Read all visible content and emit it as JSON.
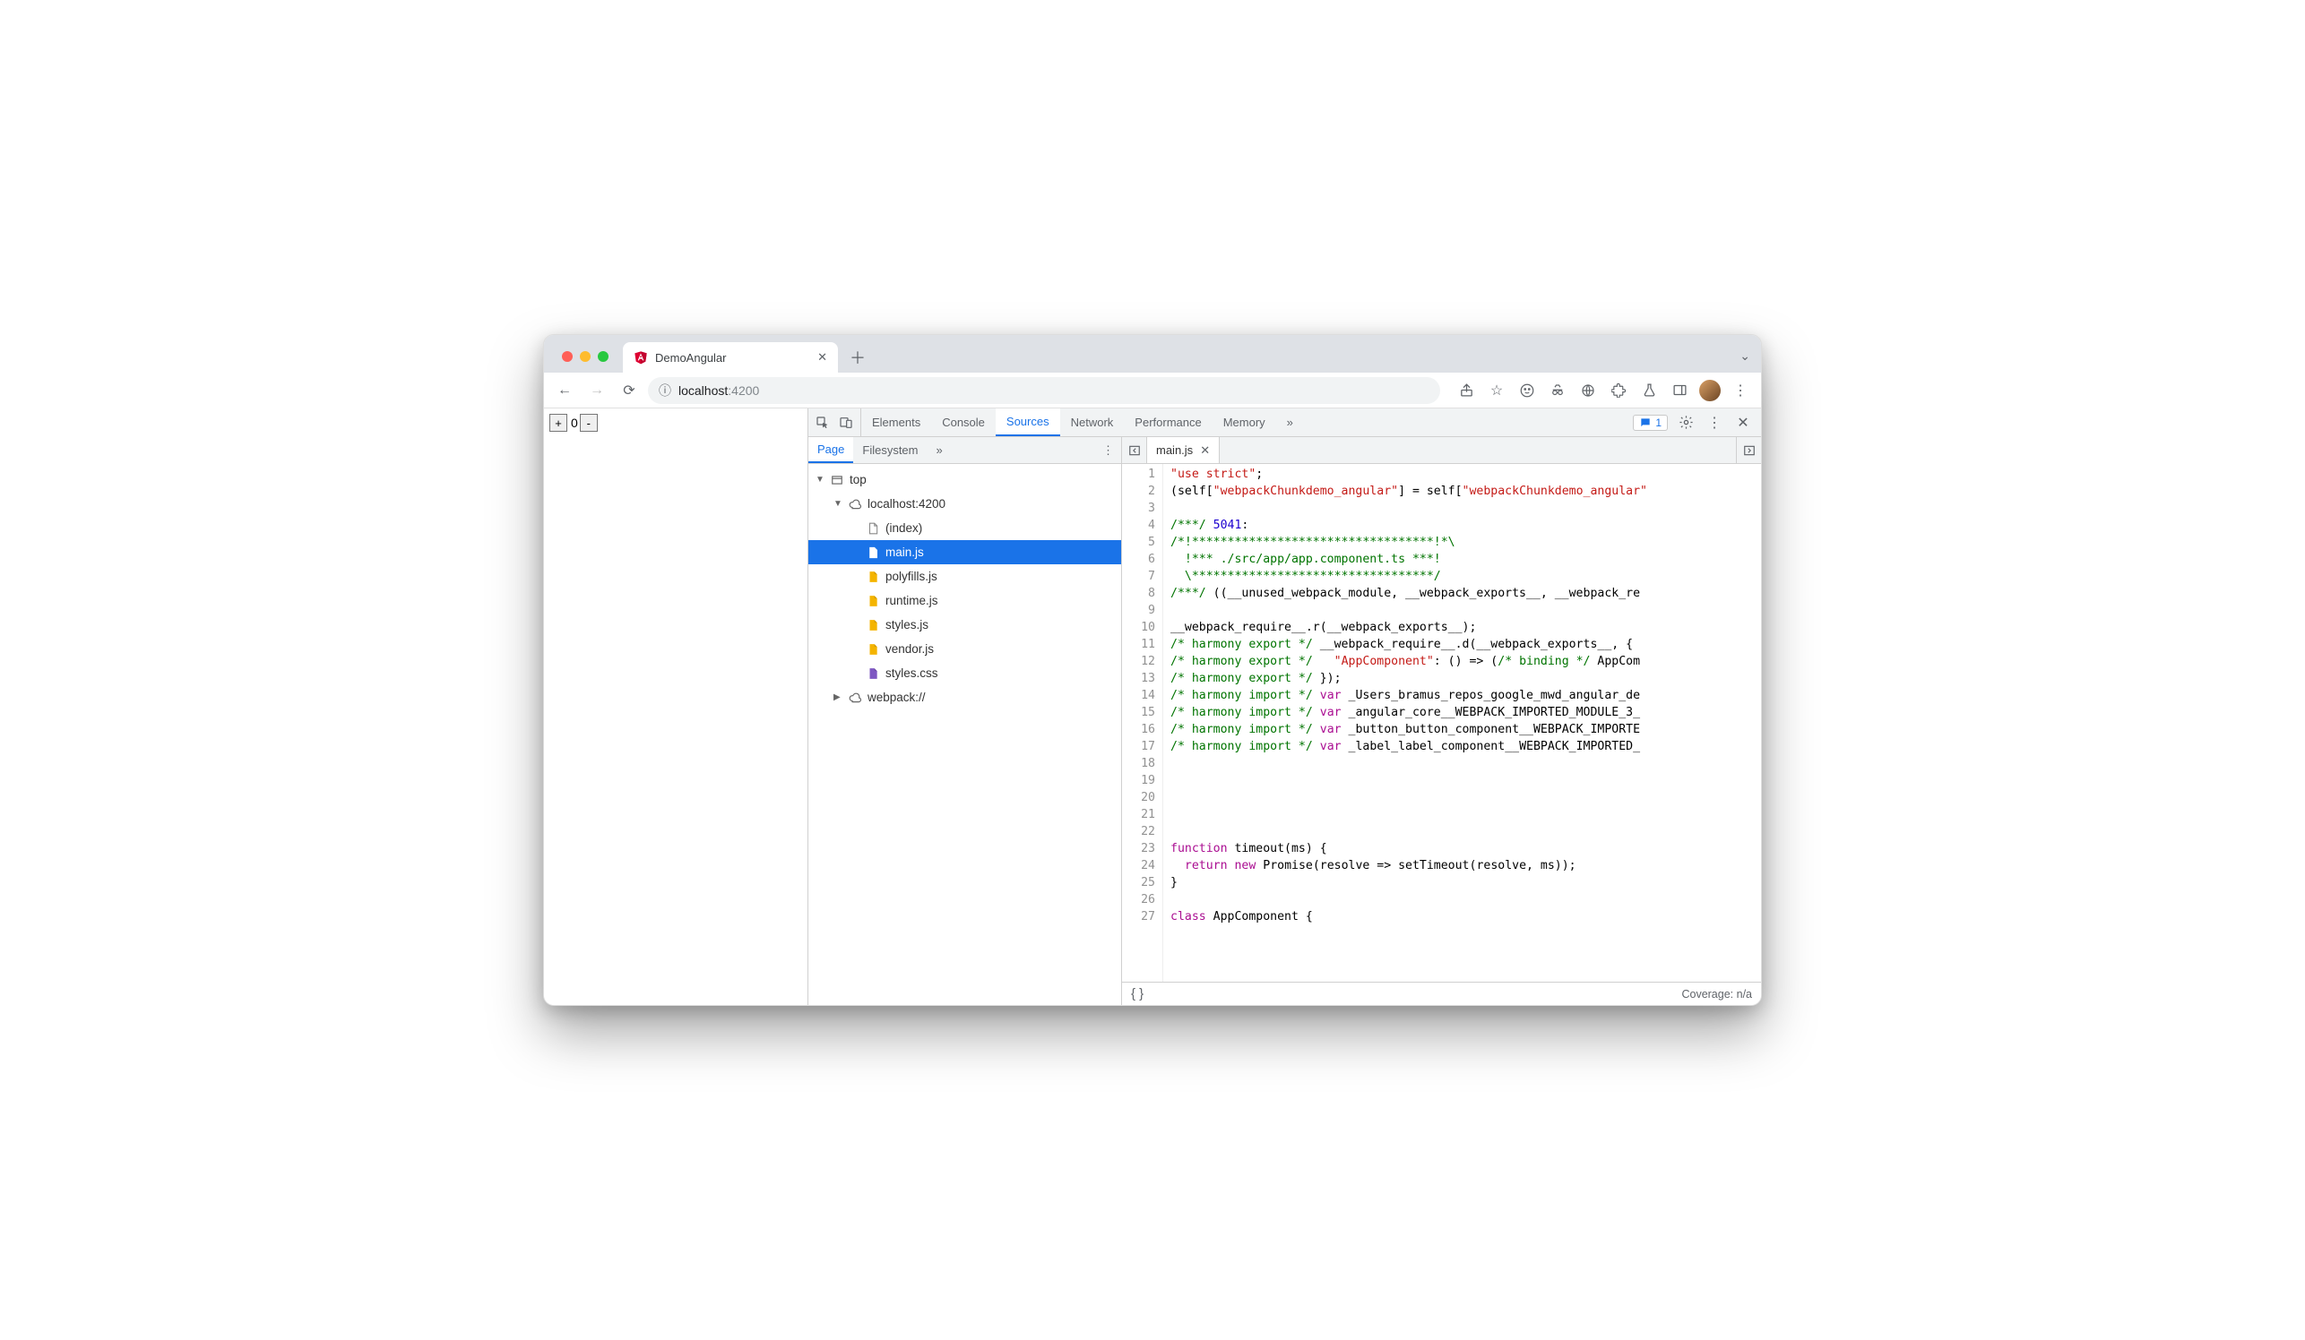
{
  "browser": {
    "tab_title": "DemoAngular",
    "url_host": "localhost",
    "url_port": ":4200",
    "counter_value": "0"
  },
  "devtools": {
    "tabs": [
      "Elements",
      "Console",
      "Sources",
      "Network",
      "Performance",
      "Memory"
    ],
    "active_tab": "Sources",
    "issues_count": "1",
    "navigator": {
      "tabs": [
        "Page",
        "Filesystem"
      ],
      "active_tab": "Page",
      "tree": {
        "top": "top",
        "origin": "localhost:4200",
        "files": [
          {
            "name": "(index)",
            "type": "html"
          },
          {
            "name": "main.js",
            "type": "js",
            "selected": true
          },
          {
            "name": "polyfills.js",
            "type": "js"
          },
          {
            "name": "runtime.js",
            "type": "js"
          },
          {
            "name": "styles.js",
            "type": "js"
          },
          {
            "name": "vendor.js",
            "type": "js"
          },
          {
            "name": "styles.css",
            "type": "css"
          }
        ],
        "webpack": "webpack://"
      }
    },
    "editor": {
      "open_file": "main.js",
      "coverage": "Coverage: n/a"
    }
  },
  "code_lines": [
    [
      {
        "t": "str",
        "v": "\"use strict\""
      },
      {
        "t": "",
        "v": ";"
      }
    ],
    [
      {
        "t": "",
        "v": "(self["
      },
      {
        "t": "prop",
        "v": "\"webpackChunkdemo_angular\""
      },
      {
        "t": "",
        "v": "] = self["
      },
      {
        "t": "prop",
        "v": "\"webpackChunkdemo_angular\""
      }
    ],
    [],
    [
      {
        "t": "com",
        "v": "/***/ "
      },
      {
        "t": "num",
        "v": "5041"
      },
      {
        "t": "",
        "v": ":"
      }
    ],
    [
      {
        "t": "com",
        "v": "/*!**********************************!*\\"
      }
    ],
    [
      {
        "t": "com",
        "v": "  !*** ./src/app/app.component.ts ***!"
      }
    ],
    [
      {
        "t": "com",
        "v": "  \\**********************************/"
      }
    ],
    [
      {
        "t": "com",
        "v": "/***/"
      },
      {
        "t": "",
        "v": " ((__unused_webpack_module, __webpack_exports__, __webpack_re"
      }
    ],
    [],
    [
      {
        "t": "",
        "v": "__webpack_require__.r(__webpack_exports__);"
      }
    ],
    [
      {
        "t": "com",
        "v": "/* harmony export */"
      },
      {
        "t": "",
        "v": " __webpack_require__.d(__webpack_exports__, {"
      }
    ],
    [
      {
        "t": "com",
        "v": "/* harmony export */"
      },
      {
        "t": "",
        "v": "   "
      },
      {
        "t": "prop",
        "v": "\"AppComponent\""
      },
      {
        "t": "",
        "v": ": () => ("
      },
      {
        "t": "com",
        "v": "/* binding */"
      },
      {
        "t": "",
        "v": " AppCom"
      }
    ],
    [
      {
        "t": "com",
        "v": "/* harmony export */"
      },
      {
        "t": "",
        "v": " });"
      }
    ],
    [
      {
        "t": "com",
        "v": "/* harmony import */"
      },
      {
        "t": "",
        "v": " "
      },
      {
        "t": "kw",
        "v": "var"
      },
      {
        "t": "",
        "v": " _Users_bramus_repos_google_mwd_angular_de"
      }
    ],
    [
      {
        "t": "com",
        "v": "/* harmony import */"
      },
      {
        "t": "",
        "v": " "
      },
      {
        "t": "kw",
        "v": "var"
      },
      {
        "t": "",
        "v": " _angular_core__WEBPACK_IMPORTED_MODULE_3_"
      }
    ],
    [
      {
        "t": "com",
        "v": "/* harmony import */"
      },
      {
        "t": "",
        "v": " "
      },
      {
        "t": "kw",
        "v": "var"
      },
      {
        "t": "",
        "v": " _button_button_component__WEBPACK_IMPORTE"
      }
    ],
    [
      {
        "t": "com",
        "v": "/* harmony import */"
      },
      {
        "t": "",
        "v": " "
      },
      {
        "t": "kw",
        "v": "var"
      },
      {
        "t": "",
        "v": " _label_label_component__WEBPACK_IMPORTED_"
      }
    ],
    [],
    [],
    [],
    [],
    [],
    [
      {
        "t": "kw",
        "v": "function"
      },
      {
        "t": "",
        "v": " timeout(ms) {"
      }
    ],
    [
      {
        "t": "",
        "v": "  "
      },
      {
        "t": "kw",
        "v": "return"
      },
      {
        "t": "",
        "v": " "
      },
      {
        "t": "kw",
        "v": "new"
      },
      {
        "t": "",
        "v": " Promise(resolve => setTimeout(resolve, ms));"
      }
    ],
    [
      {
        "t": "",
        "v": "}"
      }
    ],
    [],
    [
      {
        "t": "kw",
        "v": "class"
      },
      {
        "t": "",
        "v": " AppComponent {"
      }
    ]
  ]
}
